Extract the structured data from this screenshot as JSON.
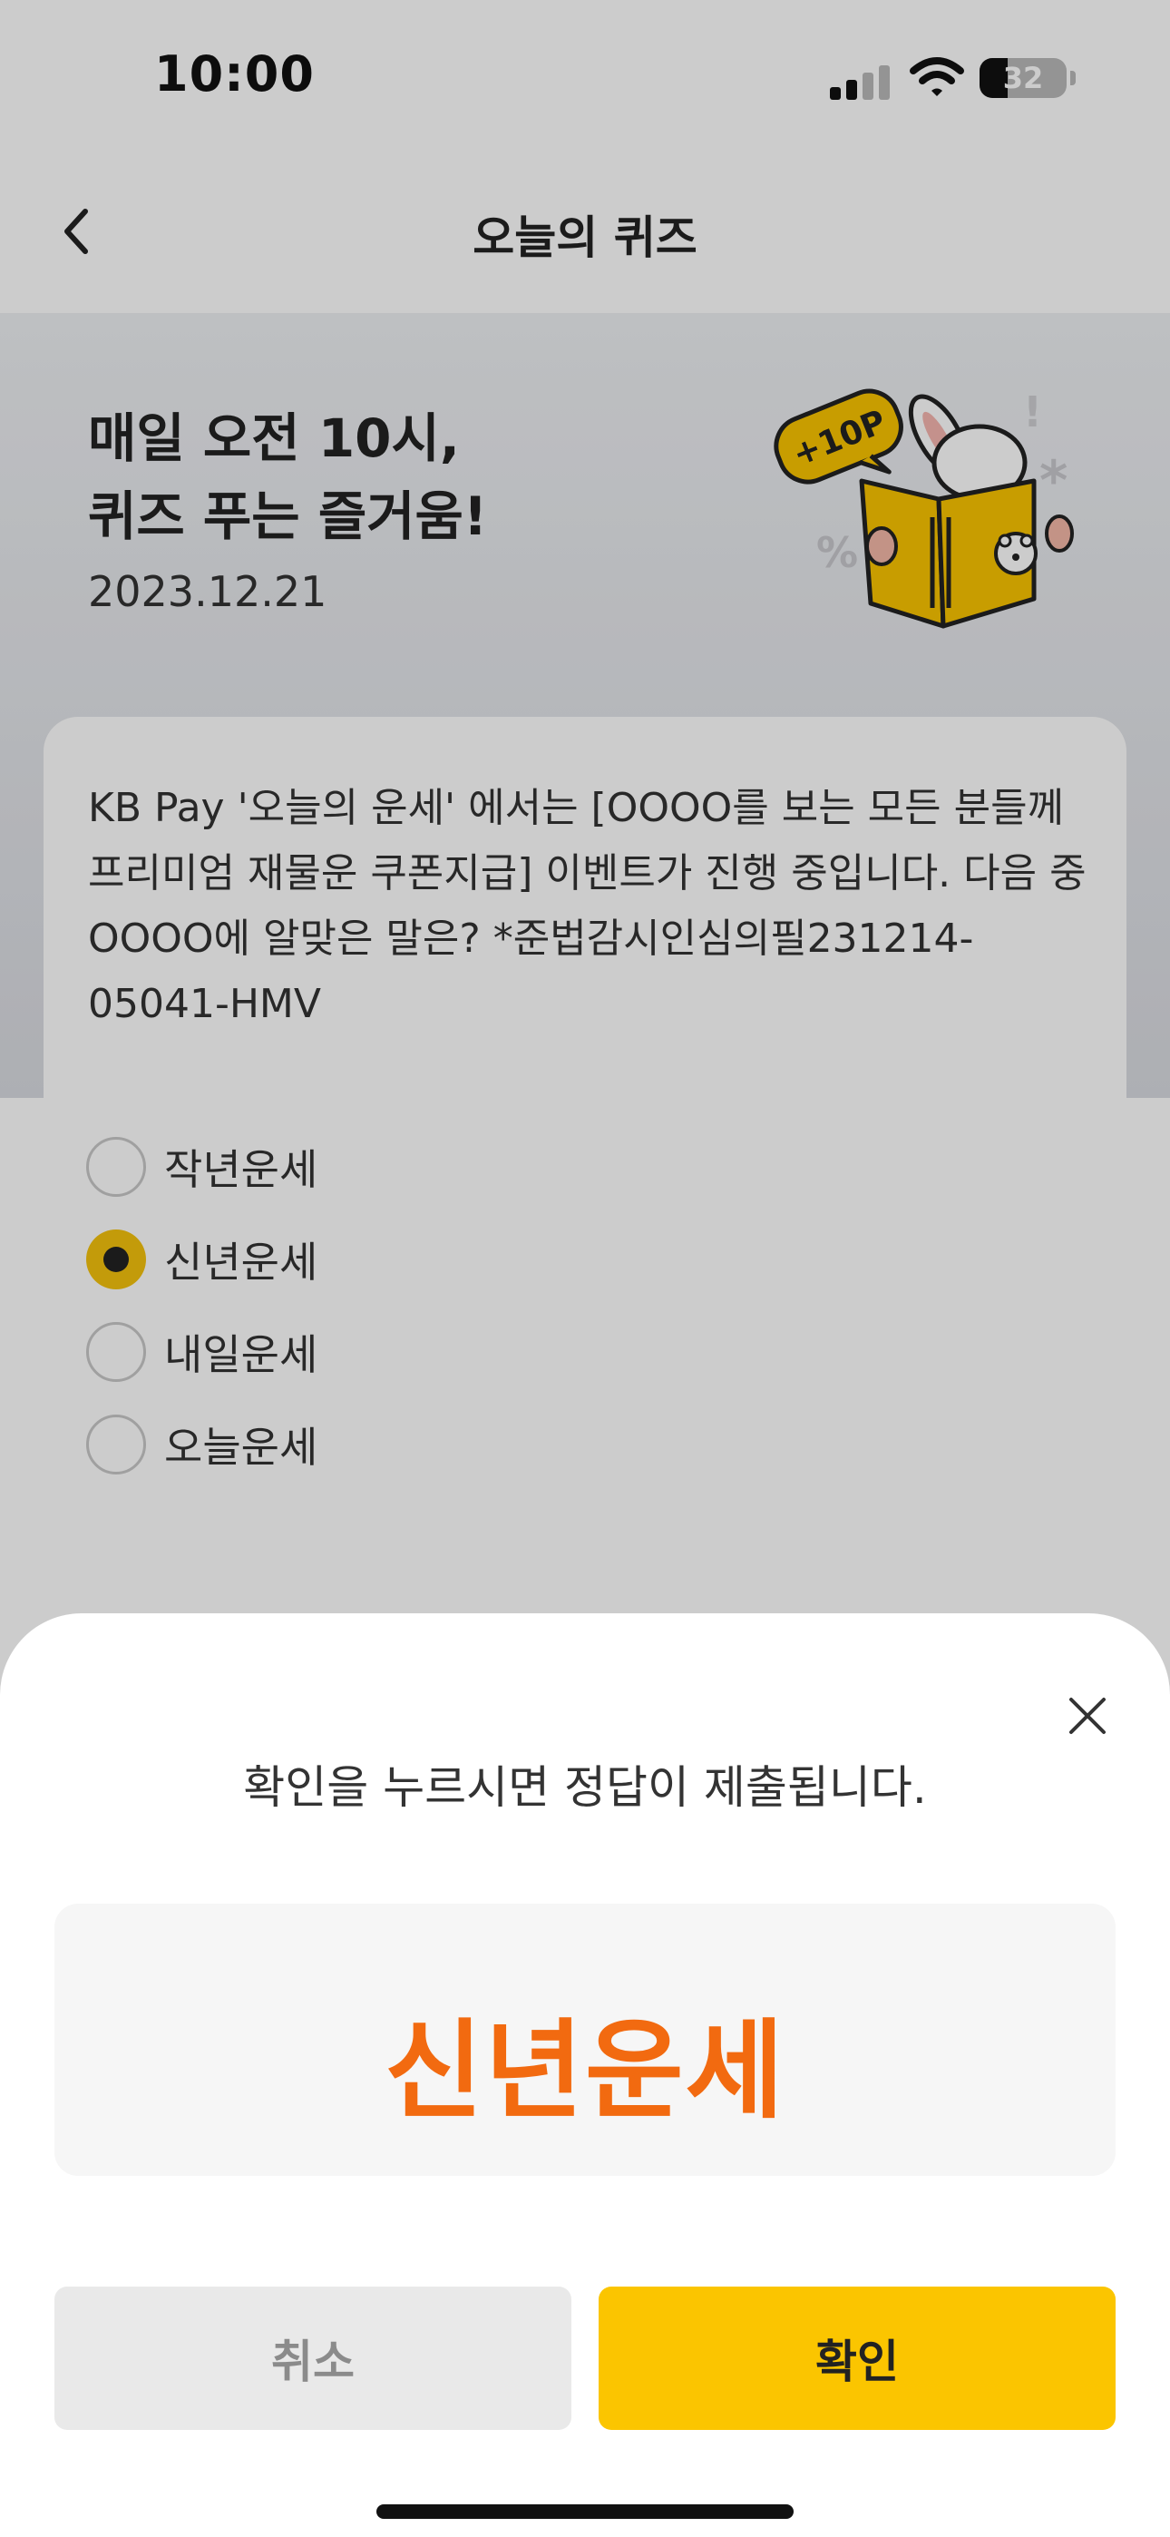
{
  "status_bar": {
    "time": "10:00",
    "battery_percent": "32",
    "battery_level": 0.32
  },
  "header": {
    "title": "오늘의 퀴즈",
    "back_icon": "chevron-left-icon"
  },
  "hero": {
    "title_line1": "매일 오전 10시,",
    "title_line2": "퀴즈 푸는 즐거움!",
    "date": "2023.12.21",
    "badge": "+10P"
  },
  "quiz": {
    "question": "KB Pay '오늘의 운세' 에서는 [OOOO를 보는 모든 분들께 프리미엄 재물운 쿠폰지급] 이벤트가 진행 중입니다. 다음 중 OOOO에 알맞은 말은? *준법감시인심의필231214-05041-HMV",
    "options": [
      {
        "label": "작년운세",
        "selected": false
      },
      {
        "label": "신년운세",
        "selected": true
      },
      {
        "label": "내일운세",
        "selected": false
      },
      {
        "label": "오늘운세",
        "selected": false
      }
    ]
  },
  "sheet": {
    "message": "확인을 누르시면 정답이 제출됩니다.",
    "answer": "신년운세",
    "cancel_label": "취소",
    "confirm_label": "확인",
    "close_icon": "close-icon"
  },
  "colors": {
    "accent_yellow": "#fbc500",
    "answer_orange": "#f26a10",
    "radio_selected": "#f4c20d"
  }
}
